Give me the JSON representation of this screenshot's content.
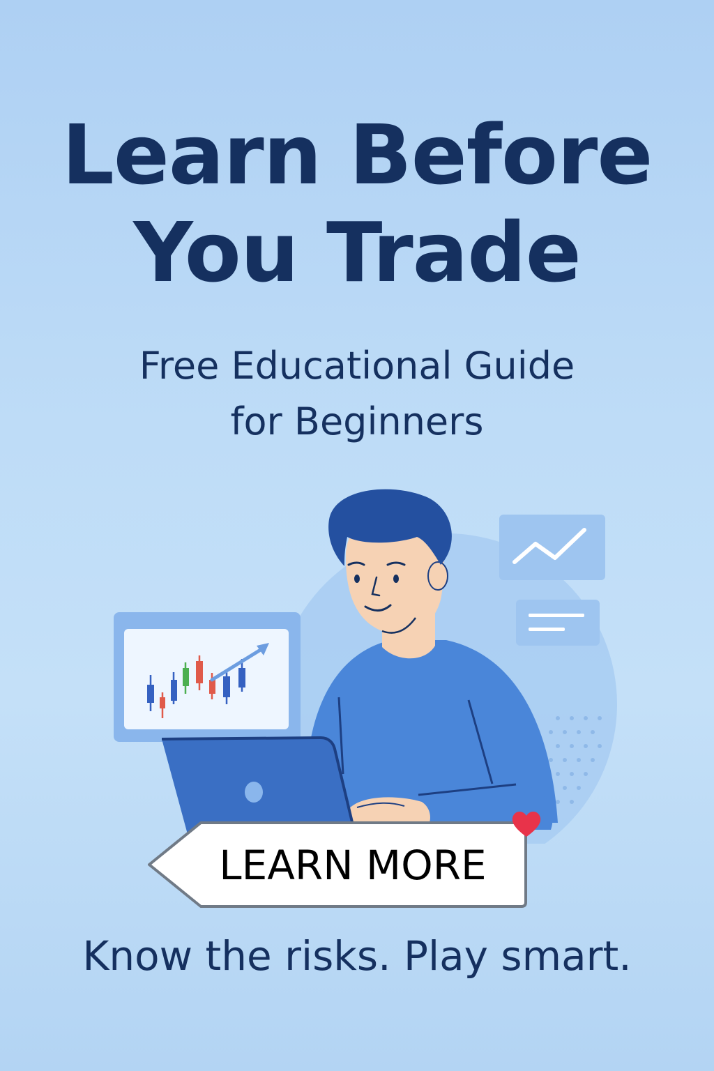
{
  "headline": {
    "line1": "Learn Before",
    "line2": "You Trade"
  },
  "subtitle": {
    "line1": "Free Educational Guide",
    "line2": "for Beginners"
  },
  "cta": {
    "label": "LEARN MORE",
    "badge_icon": "heart-icon"
  },
  "tagline": "Know the risks. Play smart.",
  "illustration": {
    "subject": "person-at-laptop-icon",
    "widgets": [
      "candlestick-chart-icon",
      "line-chart-icon",
      "text-card-icon"
    ]
  },
  "colors": {
    "headline": "#15305f",
    "sweater": "#4a86d9",
    "hair": "#2450a0",
    "skin": "#f6d2b4",
    "laptop": "#3a6fc4",
    "accent_heart": "#e8334a",
    "candle_blue": "#3561c1",
    "candle_green": "#4caf50",
    "candle_red": "#e05a4a"
  }
}
